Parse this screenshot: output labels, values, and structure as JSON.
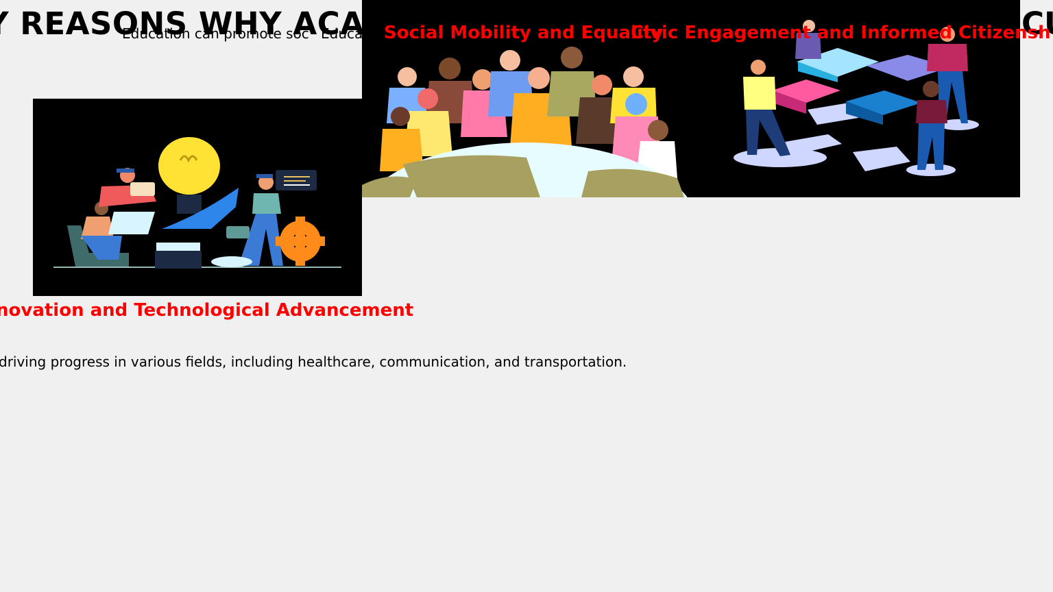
{
  "slide": {
    "title": "Y REASONS WHY ACA",
    "title_tail": "CU"
  },
  "sections": {
    "social": {
      "lead_text_1": "Education can promote soc",
      "lead_text_2": "Educa",
      "heading": "Social Mobility and Equality"
    },
    "civic": {
      "heading": "Civic Engagement and Informed Citizensh"
    },
    "innovation": {
      "heading": "novation and Technological Advancement",
      "body": "driving progress in various fields, including healthcare, communication, and transportation."
    }
  },
  "images": {
    "innovation": "innovation-illustration",
    "social": "diverse-people-globe-illustration",
    "civic": "puzzle-teamwork-illustration"
  }
}
